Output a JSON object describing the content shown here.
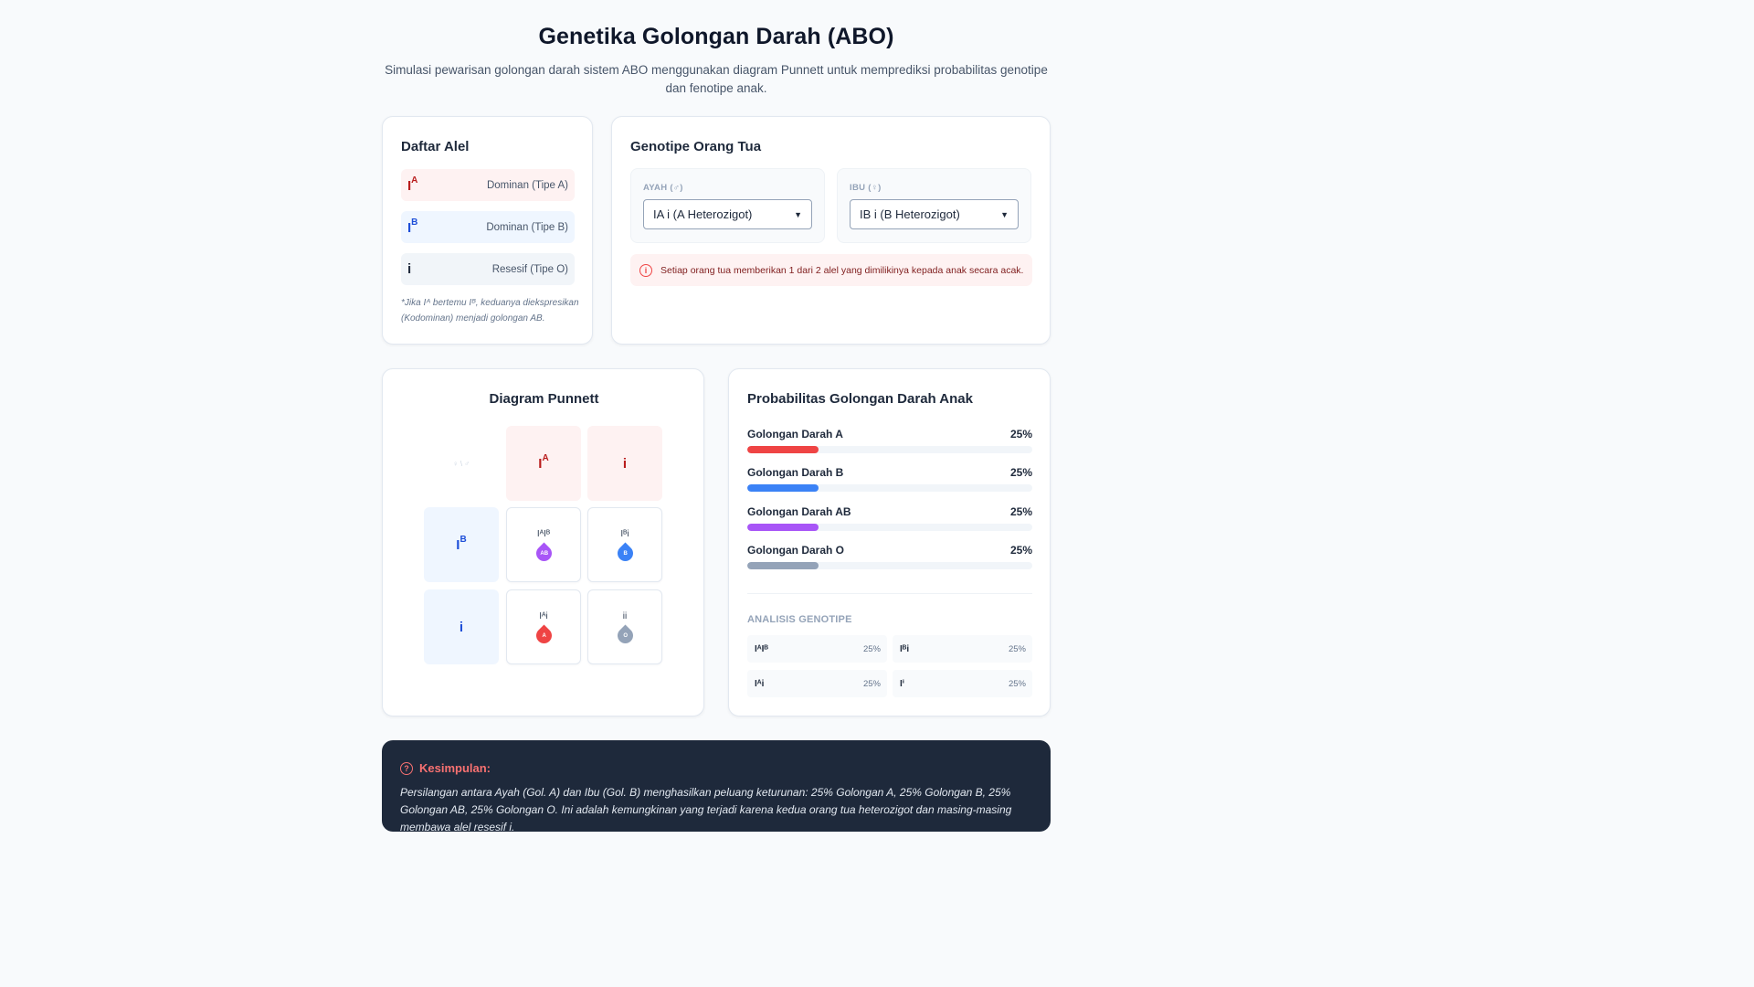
{
  "header": {
    "title": "Genetika Golongan Darah (ABO)",
    "subtitle": "Simulasi pewarisan golongan darah sistem ABO menggunakan diagram Punnett untuk memprediksi probabilitas genotipe dan fenotipe anak."
  },
  "alleles": {
    "title": "Daftar Alel",
    "items": [
      {
        "base": "I",
        "sup": "A",
        "desc": "Dominan (Tipe A)"
      },
      {
        "base": "I",
        "sup": "B",
        "desc": "Dominan (Tipe B)"
      },
      {
        "base": "i",
        "sup": "",
        "desc": "Resesif (Tipe O)"
      }
    ],
    "note": "*Jika Iᴬ bertemu Iᴮ, keduanya diekspresikan (Kodominan) menjadi golongan AB."
  },
  "parents": {
    "title": "Genotipe Orang Tua",
    "father_label": "AYAH (♂)",
    "father_value": "IA i (A Heterozigot)",
    "mother_label": "IBU (♀)",
    "mother_value": "IB i (B Heterozigot)",
    "info": "Setiap orang tua memberikan 1 dari 2 alel yang dimilikinya kepada anak secara acak."
  },
  "punnett": {
    "title": "Diagram Punnett",
    "corner": "♀ \\ ♂",
    "col_headers": [
      {
        "base": "I",
        "sup": "A"
      },
      {
        "base": "i",
        "sup": ""
      }
    ],
    "row_headers": [
      {
        "base": "I",
        "sup": "B"
      },
      {
        "base": "i",
        "sup": ""
      }
    ],
    "cells": [
      {
        "genotype": "IᴬIᴮ",
        "type": "AB",
        "color": "#a855f7"
      },
      {
        "genotype": "Iᴮi",
        "type": "B",
        "color": "#3b82f6"
      },
      {
        "genotype": "Iᴬi",
        "type": "A",
        "color": "#ef4444"
      },
      {
        "genotype": "ii",
        "type": "O",
        "color": "#94a3b8"
      }
    ]
  },
  "probability": {
    "title": "Probabilitas Golongan Darah Anak",
    "rows": [
      {
        "label": "Golongan Darah A",
        "percent": "25%",
        "value": 0.25,
        "color": "#ef4444"
      },
      {
        "label": "Golongan Darah B",
        "percent": "25%",
        "value": 0.25,
        "color": "#3b82f6"
      },
      {
        "label": "Golongan Darah AB",
        "percent": "25%",
        "value": 0.25,
        "color": "#a855f7"
      },
      {
        "label": "Golongan Darah O",
        "percent": "25%",
        "value": 0.25,
        "color": "#94a3b8"
      }
    ],
    "analysis_title": "ANALISIS GENOTIPE",
    "genotypes": [
      {
        "genotype": "IᴬIᴮ",
        "percent": "25%"
      },
      {
        "genotype": "Iᴮi",
        "percent": "25%"
      },
      {
        "genotype": "Iᴬi",
        "percent": "25%"
      },
      {
        "genotype": "Iⁱ",
        "percent": "25%"
      }
    ]
  },
  "conclusion": {
    "title": "Kesimpulan:",
    "text": "Persilangan antara Ayah (Gol. A) dan Ibu (Gol. B) menghasilkan peluang keturunan: 25% Golongan A, 25% Golongan B, 25% Golongan AB, 25% Golongan O. Ini adalah kemungkinan yang terjadi karena kedua orang tua heterozigot dan masing-masing membawa alel resesif i."
  }
}
